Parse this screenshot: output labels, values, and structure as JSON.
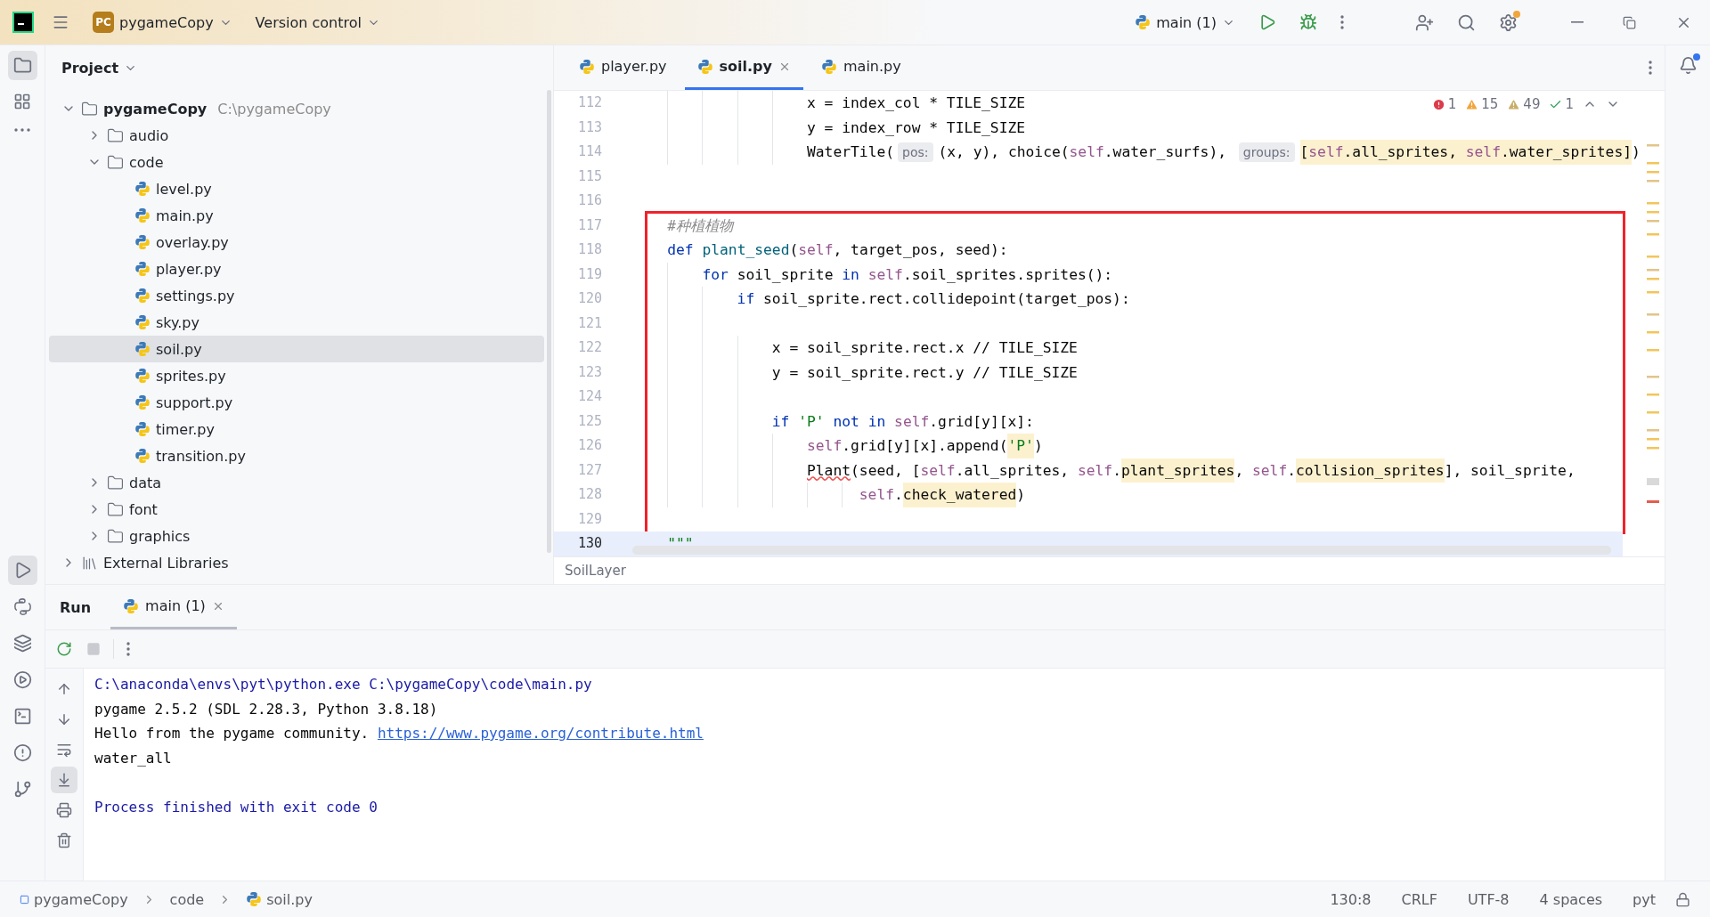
{
  "title_bar": {
    "project": {
      "badge": "PC",
      "name": "pygameCopy"
    },
    "vcs": "Version control",
    "run_config": "main (1)"
  },
  "project_panel": {
    "title": "Project",
    "tree": [
      {
        "name": "pygameCopy",
        "path": "C:\\pygameCopy",
        "kind": "folder",
        "expanded": true,
        "selected": false,
        "children": [
          {
            "name": "audio",
            "kind": "folder",
            "expanded": false,
            "selected": false
          },
          {
            "name": "code",
            "kind": "folder",
            "expanded": true,
            "selected": false,
            "children": [
              {
                "name": "level.py",
                "kind": "python",
                "selected": false
              },
              {
                "name": "main.py",
                "kind": "python",
                "selected": false
              },
              {
                "name": "overlay.py",
                "kind": "python",
                "selected": false
              },
              {
                "name": "player.py",
                "kind": "python",
                "selected": false
              },
              {
                "name": "settings.py",
                "kind": "python",
                "selected": false
              },
              {
                "name": "sky.py",
                "kind": "python",
                "selected": false
              },
              {
                "name": "soil.py",
                "kind": "python",
                "selected": true
              },
              {
                "name": "sprites.py",
                "kind": "python",
                "selected": false
              },
              {
                "name": "support.py",
                "kind": "python",
                "selected": false
              },
              {
                "name": "timer.py",
                "kind": "python",
                "selected": false
              },
              {
                "name": "transition.py",
                "kind": "python",
                "selected": false
              }
            ]
          },
          {
            "name": "data",
            "kind": "folder",
            "expanded": false,
            "selected": false
          },
          {
            "name": "font",
            "kind": "folder",
            "expanded": false,
            "selected": false
          },
          {
            "name": "graphics",
            "kind": "folder",
            "expanded": false,
            "selected": false
          }
        ]
      },
      {
        "name": "External Libraries",
        "kind": "library",
        "expanded": false,
        "selected": false
      }
    ]
  },
  "editor": {
    "tabs": [
      {
        "label": "player.py",
        "selected": false
      },
      {
        "label": "soil.py",
        "selected": true
      },
      {
        "label": "main.py",
        "selected": false
      }
    ],
    "inspections": [
      {
        "kind": "error",
        "count": "1"
      },
      {
        "kind": "warning",
        "count": "15"
      },
      {
        "kind": "weak_warning",
        "count": "49"
      },
      {
        "kind": "typo",
        "count": "1"
      }
    ],
    "blocks": [
      {
        "boxed": false,
        "lines": [
          {
            "number": "112",
            "current": false,
            "tokens": [
              {
                "kind": "plain",
                "text": "x = index_col * TILE_SIZE"
              }
            ]
          },
          {
            "number": "113",
            "current": false,
            "tokens": [
              {
                "kind": "plain",
                "text": "y = index_row * TILE_SIZE"
              }
            ]
          },
          {
            "number": "114",
            "current": false,
            "tokens": [
              {
                "kind": "plain",
                "text": "WaterTile("
              },
              {
                "kind": "hint",
                "text": "pos:"
              },
              {
                "kind": "plain",
                "text": "(x, y), choice("
              },
              {
                "kind": "self",
                "text": "self"
              },
              {
                "kind": "plain",
                "text": ".water_surfs), "
              },
              {
                "kind": "hint",
                "text": "groups:"
              },
              {
                "kind": "plain",
                "text": "[",
                "marked": true
              },
              {
                "kind": "self",
                "text": "self",
                "marked": true
              },
              {
                "kind": "plain",
                "text": ".all_sprites, ",
                "marked": true
              },
              {
                "kind": "self",
                "text": "self",
                "marked": true
              },
              {
                "kind": "plain",
                "text": ".water_sprites]",
                "marked": true
              },
              {
                "kind": "plain",
                "text": ")"
              }
            ]
          },
          {
            "number": "115",
            "current": false
          },
          {
            "number": "116",
            "current": false
          }
        ]
      },
      {
        "boxed": true,
        "lines": [
          {
            "number": "117",
            "current": false,
            "tokens": [
              {
                "kind": "comment",
                "text": "#种植植物"
              }
            ]
          },
          {
            "number": "118",
            "current": false,
            "tokens": [
              {
                "kind": "keyword",
                "text": "def "
              },
              {
                "kind": "function",
                "text": "plant_seed"
              },
              {
                "kind": "plain",
                "text": "("
              },
              {
                "kind": "self",
                "text": "self"
              },
              {
                "kind": "plain",
                "text": ", target_pos, seed):"
              }
            ]
          },
          {
            "number": "119",
            "current": false,
            "tokens": [
              {
                "kind": "keyword",
                "text": "for "
              },
              {
                "kind": "plain",
                "text": "soil_sprite "
              },
              {
                "kind": "keyword",
                "text": "in "
              },
              {
                "kind": "self",
                "text": "self"
              },
              {
                "kind": "plain",
                "text": ".soil_sprites.sprites():"
              }
            ]
          },
          {
            "number": "120",
            "current": false,
            "tokens": [
              {
                "kind": "keyword",
                "text": "if "
              },
              {
                "kind": "plain",
                "text": "soil_sprite.rect.collidepoint(target_pos):"
              }
            ]
          },
          {
            "number": "121",
            "current": false
          },
          {
            "number": "122",
            "current": false,
            "tokens": [
              {
                "kind": "plain",
                "text": "x = soil_sprite.rect.x // TILE_SIZE"
              }
            ]
          },
          {
            "number": "123",
            "current": false,
            "tokens": [
              {
                "kind": "plain",
                "text": "y = soil_sprite.rect.y // TILE_SIZE"
              }
            ]
          },
          {
            "number": "124",
            "current": false
          },
          {
            "number": "125",
            "current": false,
            "tokens": [
              {
                "kind": "keyword",
                "text": "if "
              },
              {
                "kind": "string",
                "text": "'P' "
              },
              {
                "kind": "keyword",
                "text": "not in "
              },
              {
                "kind": "self",
                "text": "self"
              },
              {
                "kind": "plain",
                "text": ".grid[y][x]:"
              }
            ]
          },
          {
            "number": "126",
            "current": false,
            "tokens": [
              {
                "kind": "self",
                "text": "self"
              },
              {
                "kind": "plain",
                "text": ".grid[y][x].append("
              },
              {
                "kind": "string",
                "text": "'P'",
                "marked": true
              },
              {
                "kind": "plain",
                "text": ")"
              }
            ]
          },
          {
            "number": "127",
            "current": false,
            "tokens": [
              {
                "kind": "error",
                "text": "Plant"
              },
              {
                "kind": "plain",
                "text": "(seed, ["
              },
              {
                "kind": "self",
                "text": "self"
              },
              {
                "kind": "plain",
                "text": ".all_sprites, "
              },
              {
                "kind": "self",
                "text": "self"
              },
              {
                "kind": "plain",
                "text": "."
              },
              {
                "kind": "plain",
                "text": "plant_sprites",
                "marked": true
              },
              {
                "kind": "plain",
                "text": ", "
              },
              {
                "kind": "self",
                "text": "self"
              },
              {
                "kind": "plain",
                "text": "."
              },
              {
                "kind": "plain",
                "text": "collision_sprites",
                "marked": true
              },
              {
                "kind": "plain",
                "text": "], soil_sprite,"
              }
            ]
          },
          {
            "number": "128",
            "current": false,
            "tokens": [
              {
                "kind": "self",
                "text": "self"
              },
              {
                "kind": "plain",
                "text": "."
              },
              {
                "kind": "plain",
                "text": "check_watered",
                "marked": true
              },
              {
                "kind": "plain",
                "text": ")"
              }
            ]
          },
          {
            "number": "129",
            "current": false
          }
        ]
      },
      {
        "boxed": false,
        "lines": [
          {
            "number": "130",
            "current": true,
            "tokens": [
              {
                "kind": "string",
                "text": "\"\"\""
              }
            ]
          }
        ]
      }
    ],
    "breadcrumb": "SoilLayer"
  },
  "run_panel": {
    "title": "Run",
    "tabs": [
      {
        "label": "main (1)",
        "selected": true
      }
    ],
    "console": [
      {
        "kind": "system",
        "text": "C:\\anaconda\\envs\\pyt\\python.exe C:\\pygameCopy\\code\\main.py"
      },
      {
        "kind": "output",
        "text": "pygame 2.5.2 (SDL 2.28.3, Python 3.8.18)"
      },
      {
        "kind": "output",
        "text": "Hello from the pygame community.",
        "link": "https://www.pygame.org/contribute.html"
      },
      {
        "kind": "output",
        "text": "water_all"
      },
      {
        "kind": "exit",
        "text": "Process finished with exit code 0"
      }
    ]
  },
  "status_bar": {
    "path": [
      {
        "label": "pygameCopy",
        "kind": "project"
      },
      {
        "label": "code",
        "kind": "folder"
      },
      {
        "label": "soil.py",
        "kind": "python"
      }
    ],
    "items": [
      "130:8",
      "CRLF",
      "UTF-8",
      "4 spaces",
      "pyt"
    ]
  }
}
